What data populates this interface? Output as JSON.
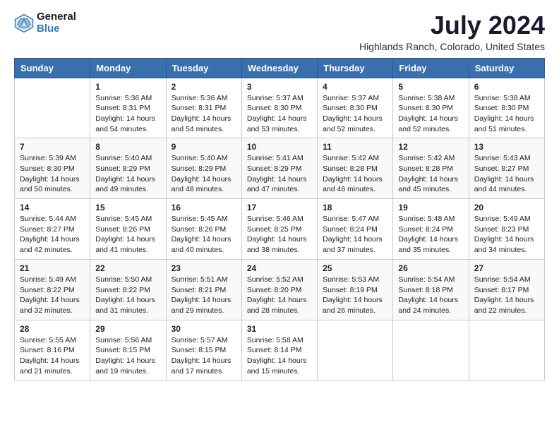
{
  "header": {
    "logo_line1": "General",
    "logo_line2": "Blue",
    "title": "July 2024",
    "subtitle": "Highlands Ranch, Colorado, United States"
  },
  "columns": [
    "Sunday",
    "Monday",
    "Tuesday",
    "Wednesday",
    "Thursday",
    "Friday",
    "Saturday"
  ],
  "weeks": [
    [
      {
        "day": "",
        "info": ""
      },
      {
        "day": "1",
        "info": "Sunrise: 5:36 AM\nSunset: 8:31 PM\nDaylight: 14 hours\nand 54 minutes."
      },
      {
        "day": "2",
        "info": "Sunrise: 5:36 AM\nSunset: 8:31 PM\nDaylight: 14 hours\nand 54 minutes."
      },
      {
        "day": "3",
        "info": "Sunrise: 5:37 AM\nSunset: 8:30 PM\nDaylight: 14 hours\nand 53 minutes."
      },
      {
        "day": "4",
        "info": "Sunrise: 5:37 AM\nSunset: 8:30 PM\nDaylight: 14 hours\nand 52 minutes."
      },
      {
        "day": "5",
        "info": "Sunrise: 5:38 AM\nSunset: 8:30 PM\nDaylight: 14 hours\nand 52 minutes."
      },
      {
        "day": "6",
        "info": "Sunrise: 5:38 AM\nSunset: 8:30 PM\nDaylight: 14 hours\nand 51 minutes."
      }
    ],
    [
      {
        "day": "7",
        "info": "Sunrise: 5:39 AM\nSunset: 8:30 PM\nDaylight: 14 hours\nand 50 minutes."
      },
      {
        "day": "8",
        "info": "Sunrise: 5:40 AM\nSunset: 8:29 PM\nDaylight: 14 hours\nand 49 minutes."
      },
      {
        "day": "9",
        "info": "Sunrise: 5:40 AM\nSunset: 8:29 PM\nDaylight: 14 hours\nand 48 minutes."
      },
      {
        "day": "10",
        "info": "Sunrise: 5:41 AM\nSunset: 8:29 PM\nDaylight: 14 hours\nand 47 minutes."
      },
      {
        "day": "11",
        "info": "Sunrise: 5:42 AM\nSunset: 8:28 PM\nDaylight: 14 hours\nand 46 minutes."
      },
      {
        "day": "12",
        "info": "Sunrise: 5:42 AM\nSunset: 8:28 PM\nDaylight: 14 hours\nand 45 minutes."
      },
      {
        "day": "13",
        "info": "Sunrise: 5:43 AM\nSunset: 8:27 PM\nDaylight: 14 hours\nand 44 minutes."
      }
    ],
    [
      {
        "day": "14",
        "info": "Sunrise: 5:44 AM\nSunset: 8:27 PM\nDaylight: 14 hours\nand 42 minutes."
      },
      {
        "day": "15",
        "info": "Sunrise: 5:45 AM\nSunset: 8:26 PM\nDaylight: 14 hours\nand 41 minutes."
      },
      {
        "day": "16",
        "info": "Sunrise: 5:45 AM\nSunset: 8:26 PM\nDaylight: 14 hours\nand 40 minutes."
      },
      {
        "day": "17",
        "info": "Sunrise: 5:46 AM\nSunset: 8:25 PM\nDaylight: 14 hours\nand 38 minutes."
      },
      {
        "day": "18",
        "info": "Sunrise: 5:47 AM\nSunset: 8:24 PM\nDaylight: 14 hours\nand 37 minutes."
      },
      {
        "day": "19",
        "info": "Sunrise: 5:48 AM\nSunset: 8:24 PM\nDaylight: 14 hours\nand 35 minutes."
      },
      {
        "day": "20",
        "info": "Sunrise: 5:49 AM\nSunset: 8:23 PM\nDaylight: 14 hours\nand 34 minutes."
      }
    ],
    [
      {
        "day": "21",
        "info": "Sunrise: 5:49 AM\nSunset: 8:22 PM\nDaylight: 14 hours\nand 32 minutes."
      },
      {
        "day": "22",
        "info": "Sunrise: 5:50 AM\nSunset: 8:22 PM\nDaylight: 14 hours\nand 31 minutes."
      },
      {
        "day": "23",
        "info": "Sunrise: 5:51 AM\nSunset: 8:21 PM\nDaylight: 14 hours\nand 29 minutes."
      },
      {
        "day": "24",
        "info": "Sunrise: 5:52 AM\nSunset: 8:20 PM\nDaylight: 14 hours\nand 28 minutes."
      },
      {
        "day": "25",
        "info": "Sunrise: 5:53 AM\nSunset: 8:19 PM\nDaylight: 14 hours\nand 26 minutes."
      },
      {
        "day": "26",
        "info": "Sunrise: 5:54 AM\nSunset: 8:18 PM\nDaylight: 14 hours\nand 24 minutes."
      },
      {
        "day": "27",
        "info": "Sunrise: 5:54 AM\nSunset: 8:17 PM\nDaylight: 14 hours\nand 22 minutes."
      }
    ],
    [
      {
        "day": "28",
        "info": "Sunrise: 5:55 AM\nSunset: 8:16 PM\nDaylight: 14 hours\nand 21 minutes."
      },
      {
        "day": "29",
        "info": "Sunrise: 5:56 AM\nSunset: 8:15 PM\nDaylight: 14 hours\nand 19 minutes."
      },
      {
        "day": "30",
        "info": "Sunrise: 5:57 AM\nSunset: 8:15 PM\nDaylight: 14 hours\nand 17 minutes."
      },
      {
        "day": "31",
        "info": "Sunrise: 5:58 AM\nSunset: 8:14 PM\nDaylight: 14 hours\nand 15 minutes."
      },
      {
        "day": "",
        "info": ""
      },
      {
        "day": "",
        "info": ""
      },
      {
        "day": "",
        "info": ""
      }
    ]
  ]
}
